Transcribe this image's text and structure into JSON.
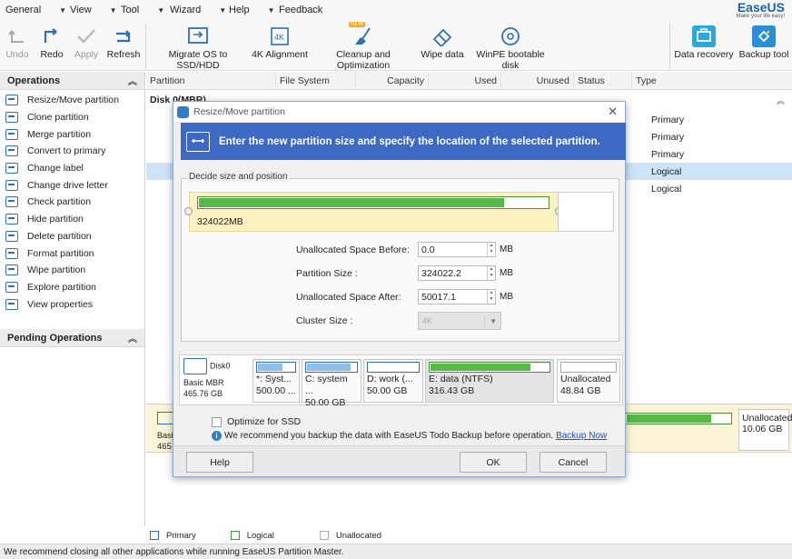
{
  "menu": {
    "items": [
      "General",
      "View",
      "Tool",
      "Wizard",
      "Help",
      "Feedback"
    ]
  },
  "logo": {
    "brand": "EaseUS",
    "tagline": "Make your life easy!"
  },
  "toolbar": {
    "undo": "Undo",
    "redo": "Redo",
    "apply": "Apply",
    "refresh": "Refresh",
    "migrate": "Migrate OS to SSD/HDD",
    "align": "4K Alignment",
    "cleanup": "Cleanup and Optimization",
    "cleanup_badge": "NEW",
    "wipe": "Wipe data",
    "winpe": "WinPE bootable disk",
    "data_recovery": "Data recovery",
    "backup_tool": "Backup tool"
  },
  "sidebar": {
    "operations_title": "Operations",
    "operations": [
      "Resize/Move partition",
      "Clone partition",
      "Merge partition",
      "Convert to primary",
      "Change label",
      "Change drive letter",
      "Check partition",
      "Hide partition",
      "Delete partition",
      "Format partition",
      "Wipe partition",
      "Explore partition",
      "View properties"
    ],
    "pending_title": "Pending Operations"
  },
  "table": {
    "columns": [
      "Partition",
      "File System",
      "Capacity",
      "Used",
      "Unused",
      "Status",
      "Type"
    ],
    "disk_label": "Disk 0(MBR)",
    "row_types": [
      "Primary",
      "Primary",
      "Primary",
      "Logical",
      "Logical"
    ]
  },
  "bottom_disk": {
    "label_short": "Basi",
    "size_short": "465",
    "unalloc_label": "Unallocated",
    "unalloc_size": "10.06 GB"
  },
  "legend": {
    "primary": "Primary",
    "logical": "Logical",
    "unallocated": "Unallocated"
  },
  "status_bar": "We recommend closing all other applications while running EaseUS Partition Master.",
  "dialog": {
    "title": "Resize/Move partition",
    "banner": "Enter the new partition size and specify the location of the selected partition.",
    "group_label": "Decide size and position",
    "slider_size": "324022MB",
    "slider_fill_fraction": 0.87,
    "fields": {
      "before_label": "Unallocated Space Before:",
      "before_value": "0.0",
      "size_label": "Partition Size :",
      "size_value": "324022.2",
      "after_label": "Unallocated Space After:",
      "after_value": "50017.1",
      "unit": "MB",
      "cluster_label": "Cluster Size :",
      "cluster_value": "4K"
    },
    "disk_map": {
      "disk_name": "Disk0",
      "disk_type": "Basic MBR",
      "disk_size": "465.76 GB",
      "partitions": [
        {
          "name": "*: Syst...",
          "size": "500.00 ...",
          "kind": "primary",
          "fill": 0.7
        },
        {
          "name": "C: system ...",
          "size": "50.00 GB",
          "kind": "primary",
          "fill": 0.9
        },
        {
          "name": "D: work (...",
          "size": "50.00 GB",
          "kind": "primary",
          "fill": 0.0
        },
        {
          "name": "E: data (NTFS)",
          "size": "316.43 GB",
          "kind": "logical",
          "fill": 0.85
        },
        {
          "name": "Unallocated",
          "size": "48.84 GB",
          "kind": "unalloc",
          "fill": 0.0
        }
      ]
    },
    "optimize_label": "Optimize for SSD",
    "recommend_text": "We recommend you backup the data with EaseUS Todo Backup before operation.",
    "backup_link": "Backup Now",
    "help_button": "Help",
    "ok_button": "OK",
    "cancel_button": "Cancel"
  }
}
